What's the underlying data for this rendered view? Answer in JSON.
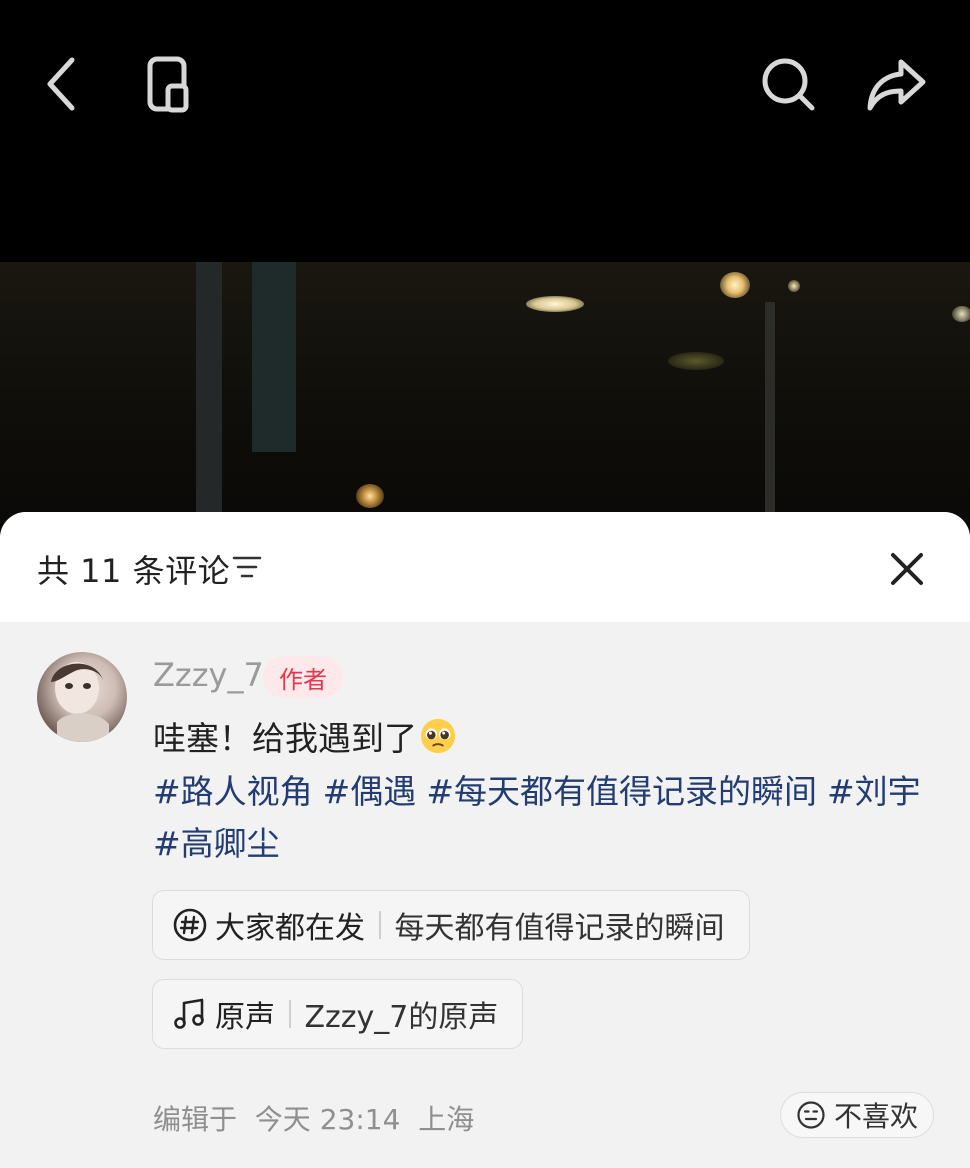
{
  "topbar": {
    "back_icon": "chevron-left-icon",
    "mini_window_icon": "mini-window-icon",
    "search_icon": "search-icon",
    "share_icon": "share-arrow-icon"
  },
  "comments_sheet": {
    "count_text": "共 11 条评论",
    "sort_icon": "sort-lines-icon",
    "close_icon": "close-icon"
  },
  "post": {
    "username": "Zzzy_7",
    "author_badge": "作者",
    "text": "哇塞！给我遇到了",
    "emoji": "pleading-face-emoji",
    "hashtags": [
      "#路人视角",
      "#偶遇",
      "#每天都有值得记录的瞬间",
      "#刘宇",
      "#高卿尘"
    ],
    "topic_chip": {
      "lead": "大家都在发",
      "value": "每天都有值得记录的瞬间",
      "icon": "hashtag-icon"
    },
    "sound_chip": {
      "lead": "原声",
      "value": "Zzzy_7的原声",
      "icon": "music-note-icon"
    },
    "edit_meta": "编辑于  今天 23:14  上海",
    "dislike_label": "不喜欢",
    "dislike_icon": "neutral-face-icon"
  },
  "colors": {
    "hashtag": "#233d72",
    "badge_text": "#e8364c",
    "badge_bg": "#fde8ea",
    "sheet_bg": "#f2f2f2"
  }
}
